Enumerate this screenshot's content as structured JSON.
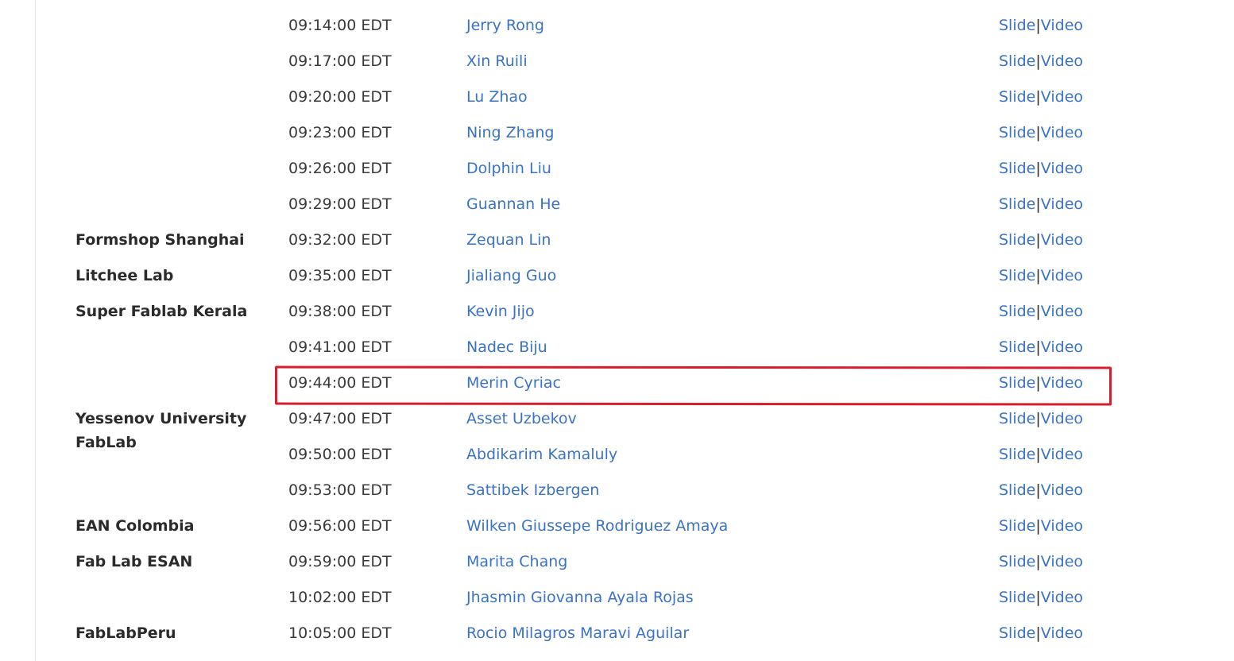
{
  "annotation": {
    "color": "#d81e2e",
    "highlighted_row_index": 10
  },
  "colors": {
    "link": "#3a73c6",
    "text": "#3a3a3a",
    "lab": "#2b2b2b"
  },
  "rows": [
    {
      "lab": "",
      "time": "09:14:00 EDT",
      "name": "Jerry Rong",
      "slide": "Slide",
      "sep": "|",
      "video": "Video"
    },
    {
      "lab": "",
      "time": "09:17:00 EDT",
      "name": "Xin Ruili",
      "slide": "Slide",
      "sep": "|",
      "video": "Video"
    },
    {
      "lab": "",
      "time": "09:20:00 EDT",
      "name": "Lu Zhao",
      "slide": "Slide",
      "sep": "|",
      "video": "Video"
    },
    {
      "lab": "",
      "time": "09:23:00 EDT",
      "name": "Ning Zhang",
      "slide": "Slide",
      "sep": "|",
      "video": "Video"
    },
    {
      "lab": "",
      "time": "09:26:00 EDT",
      "name": "Dolphin Liu",
      "slide": "Slide",
      "sep": "|",
      "video": "Video"
    },
    {
      "lab": "",
      "time": "09:29:00 EDT",
      "name": "Guannan He",
      "slide": "Slide",
      "sep": "|",
      "video": "Video"
    },
    {
      "lab": "Formshop Shanghai",
      "time": "09:32:00 EDT",
      "name": "Zequan Lin",
      "slide": "Slide",
      "sep": "|",
      "video": "Video"
    },
    {
      "lab": "Litchee Lab",
      "time": "09:35:00 EDT",
      "name": "Jialiang Guo",
      "slide": "Slide",
      "sep": "|",
      "video": "Video"
    },
    {
      "lab": "Super Fablab Kerala",
      "time": "09:38:00 EDT",
      "name": "Kevin Jijo",
      "slide": "Slide",
      "sep": "|",
      "video": "Video"
    },
    {
      "lab": "",
      "time": "09:41:00 EDT",
      "name": "Nadec Biju",
      "slide": "Slide",
      "sep": "|",
      "video": "Video"
    },
    {
      "lab": "",
      "time": "09:44:00 EDT",
      "name": "Merin Cyriac",
      "slide": "Slide",
      "sep": "|",
      "video": "Video"
    },
    {
      "lab": "Yessenov University FabLab",
      "time": "09:47:00 EDT",
      "name": "Asset Uzbekov",
      "slide": "Slide",
      "sep": "|",
      "video": "Video"
    },
    {
      "lab": "",
      "time": "09:50:00 EDT",
      "name": "Abdikarim Kamaluly",
      "slide": "Slide",
      "sep": "|",
      "video": "Video"
    },
    {
      "lab": "",
      "time": "09:53:00 EDT",
      "name": "Sattibek Izbergen",
      "slide": "Slide",
      "sep": "|",
      "video": "Video"
    },
    {
      "lab": "EAN Colombia",
      "time": "09:56:00 EDT",
      "name": "Wilken Giussepe Rodriguez Amaya",
      "slide": "Slide",
      "sep": "|",
      "video": "Video"
    },
    {
      "lab": "Fab Lab ESAN",
      "time": "09:59:00 EDT",
      "name": "Marita Chang",
      "slide": "Slide",
      "sep": "|",
      "video": "Video"
    },
    {
      "lab": "",
      "time": "10:02:00 EDT",
      "name": "Jhasmin Giovanna Ayala Rojas",
      "slide": "Slide",
      "sep": "|",
      "video": "Video"
    },
    {
      "lab": "FabLabPeru",
      "time": "10:05:00 EDT",
      "name": "Rocio Milagros Maravi Aguilar",
      "slide": "Slide",
      "sep": "|",
      "video": "Video"
    }
  ]
}
